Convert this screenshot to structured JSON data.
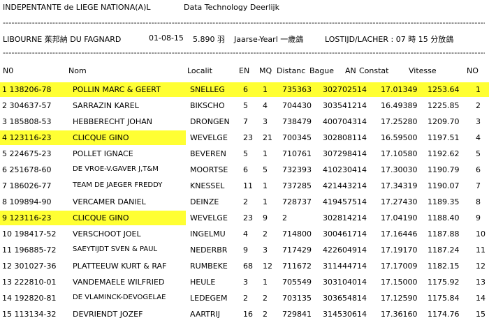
{
  "header": {
    "org": "INDEPENTANTE de LIEGE NATIONA(A)L",
    "company": "Data Technology Deerlijk",
    "dashes": "------------------------------------------------------------------------------------------------------------------------------------------------------------------------------------------------------------------------------------------------"
  },
  "race": {
    "place": "LIBOURNE 茱邦納 DU FAGNARD",
    "date": "01-08-15",
    "count": "5.890 羽",
    "category": "Jaarse-Yearl 一歲鴿",
    "release": "LOSTIJD/LACHER : 07 時 15 分放鴿"
  },
  "columns": {
    "no": "N0",
    "nom": "Nom",
    "localit": "Localit",
    "en": "EN",
    "mq": "MQ",
    "distanc": "Distanc",
    "bague": "Bague",
    "an": "AN",
    "constat": "Constat",
    "vitesse": "Vitesse",
    "pos": "NO"
  },
  "rows": [
    {
      "no": "1 138206-78",
      "nom": "POLLIN MARC & GEERT",
      "loc": "SNELLEG",
      "en": "6",
      "mq": "1",
      "dist": "735363",
      "bague": "302702514",
      "constat": "17.01349",
      "vitesse": "1253.64",
      "pos": "1",
      "highlight": "full"
    },
    {
      "no": "2 304637-57",
      "nom": "SARRAZIN KAREL",
      "loc": "BIKSCHO",
      "en": "5",
      "mq": "4",
      "dist": "704430",
      "bague": "303541214",
      "constat": "16.49389",
      "vitesse": "1225.85",
      "pos": "2",
      "highlight": "none"
    },
    {
      "no": "3 185808-53",
      "nom": "HEBBERECHT JOHAN",
      "loc": "DRONGEN",
      "en": "7",
      "mq": "3",
      "dist": "738479",
      "bague": "400704314",
      "constat": "17.25280",
      "vitesse": "1209.70",
      "pos": "3",
      "highlight": "none"
    },
    {
      "no": "4 123116-23",
      "nom": "CLICQUE GINO",
      "loc": "WEVELGE",
      "en": "23",
      "mq": "21",
      "dist": "700345",
      "bague": "302808114",
      "constat": "16.59500",
      "vitesse": "1197.51",
      "pos": "4",
      "highlight": "part"
    },
    {
      "no": "5 224675-23",
      "nom": "POLLET IGNACE",
      "loc": "BEVEREN",
      "en": "5",
      "mq": "1",
      "dist": "710761",
      "bague": "307298414",
      "constat": "17.10580",
      "vitesse": "1192.62",
      "pos": "5",
      "highlight": "none"
    },
    {
      "no": "6 251678-60",
      "nom": "DE VROE-V.GAVER J,T&M",
      "loc": "MOORTSE",
      "en": "6",
      "mq": "5",
      "dist": "732393",
      "bague": "410230414",
      "constat": "17.30030",
      "vitesse": "1190.79",
      "pos": "6",
      "highlight": "none"
    },
    {
      "no": "7 186026-77",
      "nom": "TEAM DE JAEGER FREDDY",
      "loc": "KNESSEL",
      "en": "11",
      "mq": "1",
      "dist": "737285",
      "bague": "421443214",
      "constat": "17.34319",
      "vitesse": "1190.07",
      "pos": "7",
      "highlight": "none"
    },
    {
      "no": "8 109894-90",
      "nom": "VERCAMER DANIEL",
      "loc": "DEINZE",
      "en": "2",
      "mq": "1",
      "dist": "728737",
      "bague": "419457514",
      "constat": "17.27430",
      "vitesse": "1189.35",
      "pos": "8",
      "highlight": "none"
    },
    {
      "no": "9 123116-23",
      "nom": "CLICQUE GINO",
      "loc": "WEVELGE",
      "en": "23",
      "mq": "9",
      "dist": "2",
      "bague": "302814214",
      "constat": "17.04190",
      "vitesse": "1188.40",
      "pos": "9",
      "highlight": "part"
    },
    {
      "no": "10 198417-52",
      "nom": "VERSCHOOT JOEL",
      "loc": "INGELMU",
      "en": "4",
      "mq": "2",
      "dist": "714800",
      "bague": "300461714",
      "constat": "17.16446",
      "vitesse": "1187.88",
      "pos": "10",
      "highlight": "none"
    },
    {
      "no": "11 196885-72",
      "nom": "SAEYTIJDT SVEN & PAUL",
      "loc": "NEDERBR",
      "en": "9",
      "mq": "3",
      "dist": "717429",
      "bague": "422604914",
      "constat": "17.19170",
      "vitesse": "1187.24",
      "pos": "11",
      "highlight": "none"
    },
    {
      "no": "12 301027-36",
      "nom": "PLATTEEUW KURT & RAF",
      "loc": "RUMBEKE",
      "en": "68",
      "mq": "12",
      "dist": "711672",
      "bague": "311444714",
      "constat": "17.17009",
      "vitesse": "1182.15",
      "pos": "12",
      "highlight": "none"
    },
    {
      "no": "13 222810-01",
      "nom": "VANDEMAELE WILFRIED",
      "loc": "HEULE",
      "en": "3",
      "mq": "1",
      "dist": "705549",
      "bague": "303104014",
      "constat": "17.15000",
      "vitesse": "1175.92",
      "pos": "13",
      "highlight": "none"
    },
    {
      "no": "14 192820-81",
      "nom": "DE VLAMINCK-DEVOGELAE",
      "loc": "LEDEGEM",
      "en": "2",
      "mq": "2",
      "dist": "703135",
      "bague": "303654814",
      "constat": "17.12590",
      "vitesse": "1175.84",
      "pos": "14",
      "highlight": "none"
    },
    {
      "no": "15 113134-32",
      "nom": "DEVRIENDT JOZEF",
      "loc": "AARTRIJ",
      "en": "16",
      "mq": "2",
      "dist": "729841",
      "bague": "314530614",
      "constat": "17.36160",
      "vitesse": "1174.76",
      "pos": "15",
      "highlight": "none"
    }
  ],
  "colors": {
    "highlight": "#ffff33",
    "text": "#000000",
    "background": "#ffffff"
  }
}
